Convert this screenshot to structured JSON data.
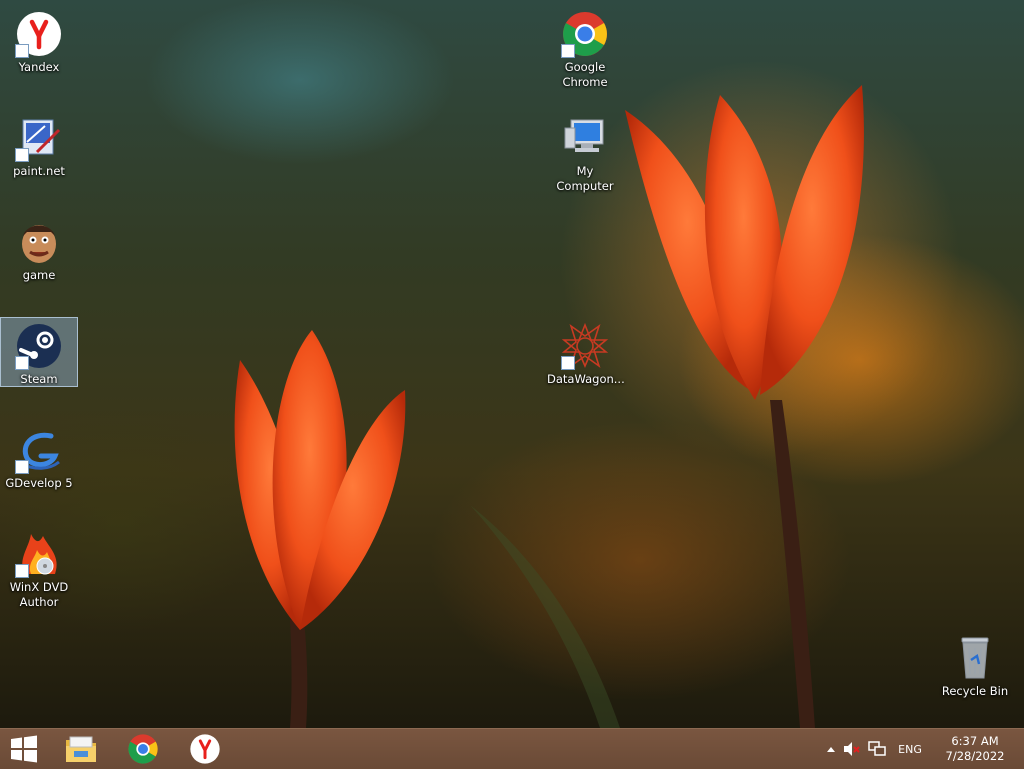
{
  "desktop": {
    "icons": [
      {
        "id": "yandex",
        "label": "Yandex"
      },
      {
        "id": "paintnet",
        "label": "paint.net"
      },
      {
        "id": "game",
        "label": "game"
      },
      {
        "id": "steam",
        "label": "Steam",
        "selected": true
      },
      {
        "id": "gdevelop",
        "label": "GDevelop 5"
      },
      {
        "id": "winx",
        "label": "WinX DVD Author"
      },
      {
        "id": "chrome",
        "label": "Google Chrome"
      },
      {
        "id": "mycomputer",
        "label": "My Computer"
      },
      {
        "id": "datawagon",
        "label": "DataWagon..."
      },
      {
        "id": "recycle",
        "label": "Recycle Bin"
      }
    ]
  },
  "taskbar": {
    "pinned": [
      "start",
      "file-explorer",
      "google-chrome",
      "yandex-browser"
    ],
    "tray": {
      "language": "ENG",
      "time": "6:37 AM",
      "date": "7/28/2022"
    }
  },
  "colors": {
    "taskbar": "#6d4c38",
    "selection": "#96b9dc",
    "tulip": "#f0501a"
  }
}
